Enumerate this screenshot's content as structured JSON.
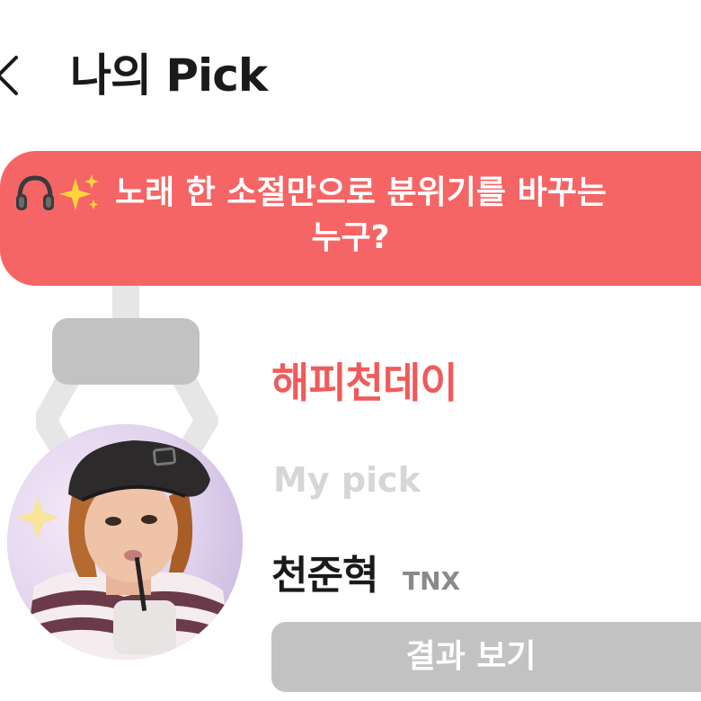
{
  "header": {
    "title": "나의 Pick",
    "back_icon": "chevron-left-icon"
  },
  "banner": {
    "icons": [
      "headphones-icon",
      "sparkles-icon"
    ],
    "question_line1": "노래 한 소절만으로 분위기를 바꾸는",
    "question_line2": "누구?",
    "color": "#f56565"
  },
  "pick": {
    "title": "해피천데이",
    "my_pick_label": "My pick",
    "name": "천준혁",
    "group": "TNX",
    "title_color": "#ef5b5b"
  },
  "result_button": {
    "label": "결과 보기",
    "color": "#c2c2c2"
  }
}
